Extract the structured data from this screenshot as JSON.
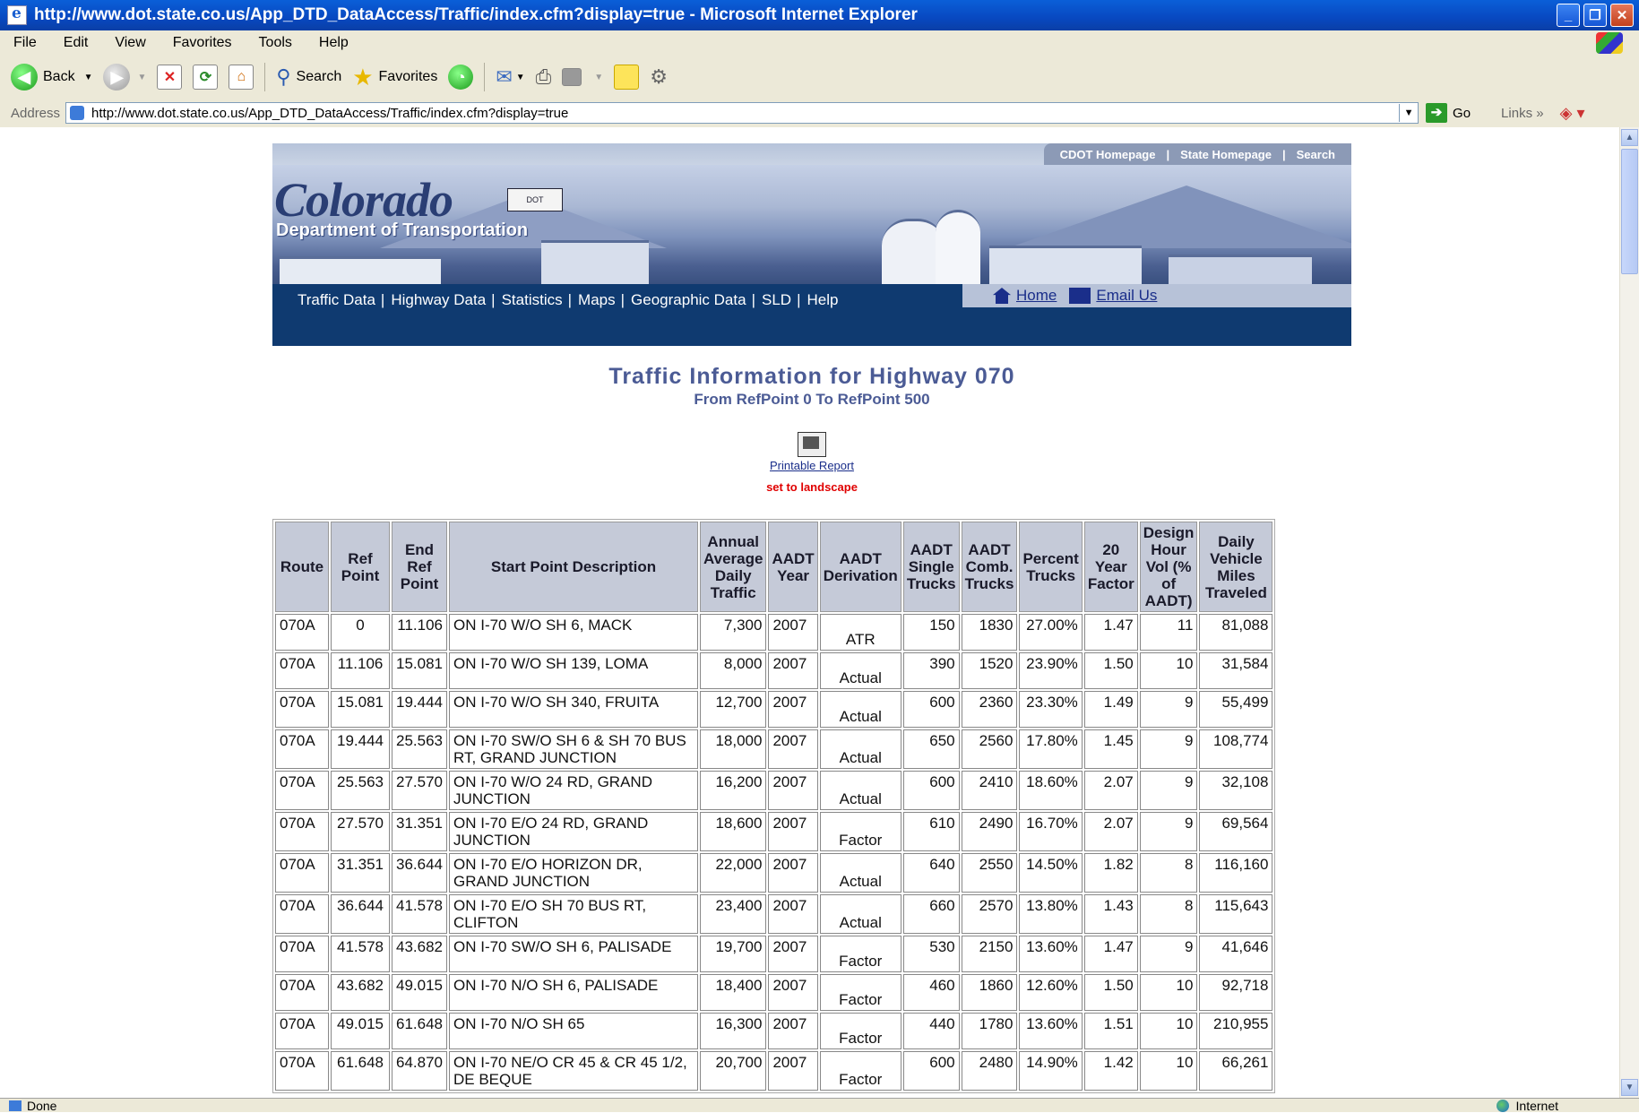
{
  "window": {
    "title": "http://www.dot.state.co.us/App_DTD_DataAccess/Traffic/index.cfm?display=true - Microsoft Internet Explorer"
  },
  "menu": [
    "File",
    "Edit",
    "View",
    "Favorites",
    "Tools",
    "Help"
  ],
  "toolbar": {
    "back": "Back",
    "search": "Search",
    "favorites": "Favorites"
  },
  "address": {
    "label": "Address",
    "url": "http://www.dot.state.co.us/App_DTD_DataAccess/Traffic/index.cfm?display=true",
    "go": "Go",
    "links": "Links"
  },
  "banner": {
    "logo": "Colorado",
    "logo_sub": "Department of Transportation",
    "badge": "DOT",
    "top_links": [
      "CDOT Homepage",
      "|",
      "State Homepage",
      "|",
      "Search"
    ],
    "nav": [
      "Traffic Data",
      "Highway Data",
      "Statistics",
      "Maps",
      "Geographic Data",
      "SLD",
      "Help"
    ],
    "home": "Home",
    "email": "Email Us"
  },
  "page": {
    "title": "Traffic Information for Highway 070",
    "subtitle": "From RefPoint 0 To RefPoint 500",
    "printable": "Printable Report",
    "landscape": "set to landscape"
  },
  "table": {
    "headers": [
      "Route",
      "Ref Point",
      "End Ref Point",
      "Start Point Description",
      "Annual Average Daily Traffic",
      "AADT Year",
      "AADT Derivation",
      "AADT Single Trucks",
      "AADT Comb. Trucks",
      "Percent Trucks",
      "20 Year Factor",
      "Design Hour Vol (% of AADT)",
      "Daily Vehicle Miles Traveled"
    ],
    "rows": [
      [
        "070A",
        "0",
        "11.106",
        "ON I-70 W/O SH 6, MACK",
        "7,300",
        "2007",
        "ATR",
        "150",
        "1830",
        "27.00%",
        "1.47",
        "11",
        "81,088"
      ],
      [
        "070A",
        "11.106",
        "15.081",
        "ON I-70 W/O SH 139, LOMA",
        "8,000",
        "2007",
        "Actual",
        "390",
        "1520",
        "23.90%",
        "1.50",
        "10",
        "31,584"
      ],
      [
        "070A",
        "15.081",
        "19.444",
        "ON I-70 W/O SH 340, FRUITA",
        "12,700",
        "2007",
        "Actual",
        "600",
        "2360",
        "23.30%",
        "1.49",
        "9",
        "55,499"
      ],
      [
        "070A",
        "19.444",
        "25.563",
        "ON I-70 SW/O SH 6 & SH 70 BUS RT, GRAND JUNCTION",
        "18,000",
        "2007",
        "Actual",
        "650",
        "2560",
        "17.80%",
        "1.45",
        "9",
        "108,774"
      ],
      [
        "070A",
        "25.563",
        "27.570",
        "ON I-70 W/O 24 RD, GRAND JUNCTION",
        "16,200",
        "2007",
        "Actual",
        "600",
        "2410",
        "18.60%",
        "2.07",
        "9",
        "32,108"
      ],
      [
        "070A",
        "27.570",
        "31.351",
        "ON I-70 E/O 24 RD, GRAND JUNCTION",
        "18,600",
        "2007",
        "Factor",
        "610",
        "2490",
        "16.70%",
        "2.07",
        "9",
        "69,564"
      ],
      [
        "070A",
        "31.351",
        "36.644",
        "ON I-70 E/O HORIZON DR, GRAND JUNCTION",
        "22,000",
        "2007",
        "Actual",
        "640",
        "2550",
        "14.50%",
        "1.82",
        "8",
        "116,160"
      ],
      [
        "070A",
        "36.644",
        "41.578",
        "ON I-70 E/O SH 70 BUS RT, CLIFTON",
        "23,400",
        "2007",
        "Actual",
        "660",
        "2570",
        "13.80%",
        "1.43",
        "8",
        "115,643"
      ],
      [
        "070A",
        "41.578",
        "43.682",
        "ON I-70 SW/O SH 6, PALISADE",
        "19,700",
        "2007",
        "Factor",
        "530",
        "2150",
        "13.60%",
        "1.47",
        "9",
        "41,646"
      ],
      [
        "070A",
        "43.682",
        "49.015",
        "ON I-70 N/O SH 6, PALISADE",
        "18,400",
        "2007",
        "Factor",
        "460",
        "1860",
        "12.60%",
        "1.50",
        "10",
        "92,718"
      ],
      [
        "070A",
        "49.015",
        "61.648",
        "ON I-70 N/O SH 65",
        "16,300",
        "2007",
        "Factor",
        "440",
        "1780",
        "13.60%",
        "1.51",
        "10",
        "210,955"
      ],
      [
        "070A",
        "61.648",
        "64.870",
        "ON I-70 NE/O CR 45 & CR 45 1/2, DE BEQUE",
        "20,700",
        "2007",
        "Factor",
        "600",
        "2480",
        "14.90%",
        "1.42",
        "10",
        "66,261"
      ]
    ]
  },
  "status": {
    "left": "Done",
    "zone": "Internet"
  }
}
